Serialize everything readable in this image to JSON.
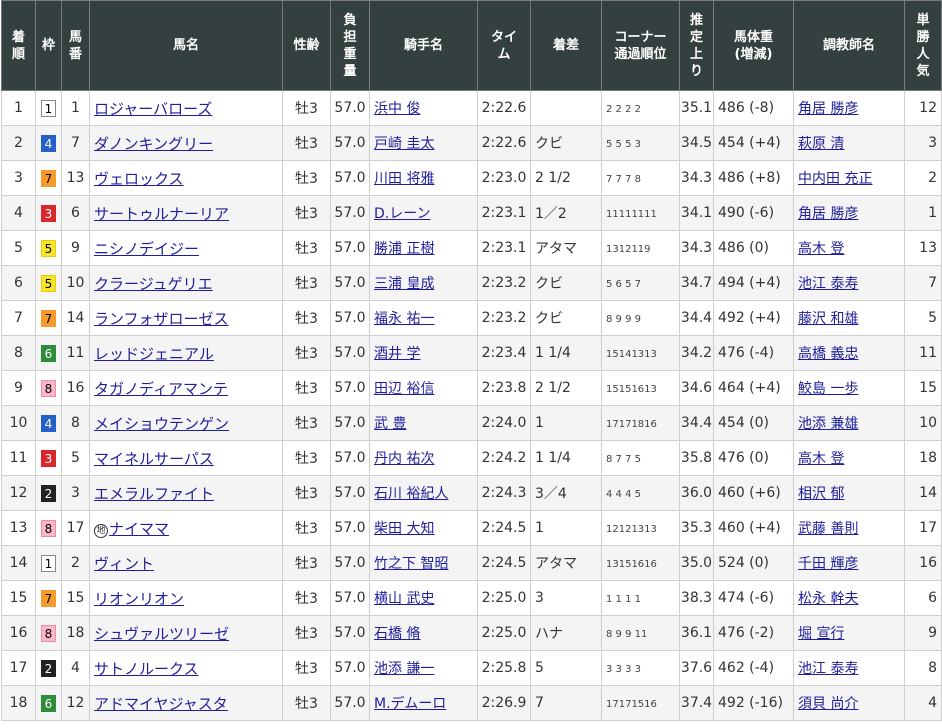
{
  "headers": {
    "rank": [
      "着",
      "順"
    ],
    "waku": "枠",
    "umaban": [
      "馬",
      "番"
    ],
    "horse": "馬名",
    "sex_age": "性齢",
    "weight_carried": [
      "負",
      "担",
      "重",
      "量"
    ],
    "jockey": "騎手名",
    "time": [
      "タイ",
      "ム"
    ],
    "margin": "着差",
    "corner": [
      "コーナー",
      "通過順位"
    ],
    "last3f": [
      "推",
      "定",
      "上",
      "り"
    ],
    "body_weight": [
      "馬体重",
      "(増減)"
    ],
    "trainer": "調教師名",
    "popularity": [
      "単",
      "勝",
      "人",
      "気"
    ]
  },
  "gate_colors": {
    "1": {
      "bg": "#ffffff",
      "fg": "#000000",
      "border": "#888888"
    },
    "2": {
      "bg": "#222222",
      "fg": "#ffffff",
      "border": "#222222"
    },
    "3": {
      "bg": "#d9282b",
      "fg": "#ffffff",
      "border": "#d9282b"
    },
    "4": {
      "bg": "#2560c8",
      "fg": "#ffffff",
      "border": "#2560c8"
    },
    "5": {
      "bg": "#f7e52a",
      "fg": "#000000",
      "border": "#e0ce10"
    },
    "6": {
      "bg": "#2e8c3a",
      "fg": "#ffffff",
      "border": "#2e8c3a"
    },
    "7": {
      "bg": "#f59a2b",
      "fg": "#000000",
      "border": "#f59a2b"
    },
    "8": {
      "bg": "#f9b8c8",
      "fg": "#000000",
      "border": "#f08aa4"
    }
  },
  "rows": [
    {
      "rank": "1",
      "waku": "1",
      "umaban": "1",
      "horse": "ロジャーバローズ",
      "chi": "",
      "sex_age": "牡3",
      "weight": "57.0",
      "jockey": "浜中 俊",
      "time": "2:22.6",
      "margin": "",
      "corner": "2 2 2 2",
      "last3f": "35.1",
      "body_weight": "486 (-8)",
      "trainer": "角居 勝彦",
      "popularity": "12"
    },
    {
      "rank": "2",
      "waku": "4",
      "umaban": "7",
      "horse": "ダノンキングリー",
      "chi": "",
      "sex_age": "牡3",
      "weight": "57.0",
      "jockey": "戸崎 圭太",
      "time": "2:22.6",
      "margin": "クビ",
      "corner": "5 5 5 3",
      "last3f": "34.5",
      "body_weight": "454 (+4)",
      "trainer": "萩原 清",
      "popularity": "3"
    },
    {
      "rank": "3",
      "waku": "7",
      "umaban": "13",
      "horse": "ヴェロックス",
      "chi": "",
      "sex_age": "牡3",
      "weight": "57.0",
      "jockey": "川田 将雅",
      "time": "2:23.0",
      "margin": "2 1/2",
      "corner": "7 7 7 8",
      "last3f": "34.3",
      "body_weight": "486 (+8)",
      "trainer": "中内田 充正",
      "popularity": "2"
    },
    {
      "rank": "4",
      "waku": "3",
      "umaban": "6",
      "horse": "サートゥルナーリア",
      "chi": "",
      "sex_age": "牡3",
      "weight": "57.0",
      "jockey": "D.レーン",
      "time": "2:23.1",
      "margin": "1／2",
      "corner": "11111111",
      "last3f": "34.1",
      "body_weight": "490 (-6)",
      "trainer": "角居 勝彦",
      "popularity": "1"
    },
    {
      "rank": "5",
      "waku": "5",
      "umaban": "9",
      "horse": "ニシノデイジー",
      "chi": "",
      "sex_age": "牡3",
      "weight": "57.0",
      "jockey": "勝浦 正樹",
      "time": "2:23.1",
      "margin": "アタマ",
      "corner": "1312119",
      "last3f": "34.3",
      "body_weight": "486 (0)",
      "trainer": "高木 登",
      "popularity": "13"
    },
    {
      "rank": "6",
      "waku": "5",
      "umaban": "10",
      "horse": "クラージュゲリエ",
      "chi": "",
      "sex_age": "牡3",
      "weight": "57.0",
      "jockey": "三浦 皇成",
      "time": "2:23.2",
      "margin": "クビ",
      "corner": "5 6 5 7",
      "last3f": "34.7",
      "body_weight": "494 (+4)",
      "trainer": "池江 泰寿",
      "popularity": "7"
    },
    {
      "rank": "7",
      "waku": "7",
      "umaban": "14",
      "horse": "ランフォザローゼス",
      "chi": "",
      "sex_age": "牡3",
      "weight": "57.0",
      "jockey": "福永 祐一",
      "time": "2:23.2",
      "margin": "クビ",
      "corner": "8 9 9 9",
      "last3f": "34.4",
      "body_weight": "492 (+4)",
      "trainer": "藤沢 和雄",
      "popularity": "5"
    },
    {
      "rank": "8",
      "waku": "6",
      "umaban": "11",
      "horse": "レッドジェニアル",
      "chi": "",
      "sex_age": "牡3",
      "weight": "57.0",
      "jockey": "酒井 学",
      "time": "2:23.4",
      "margin": "1 1/4",
      "corner": "15141313",
      "last3f": "34.2",
      "body_weight": "476 (-4)",
      "trainer": "高橋 義忠",
      "popularity": "11"
    },
    {
      "rank": "9",
      "waku": "8",
      "umaban": "16",
      "horse": "タガノディアマンテ",
      "chi": "",
      "sex_age": "牡3",
      "weight": "57.0",
      "jockey": "田辺 裕信",
      "time": "2:23.8",
      "margin": "2 1/2",
      "corner": "15151613",
      "last3f": "34.6",
      "body_weight": "464 (+4)",
      "trainer": "鮫島 一歩",
      "popularity": "15"
    },
    {
      "rank": "10",
      "waku": "4",
      "umaban": "8",
      "horse": "メイショウテンゲン",
      "chi": "",
      "sex_age": "牡3",
      "weight": "57.0",
      "jockey": "武 豊",
      "time": "2:24.0",
      "margin": "1",
      "corner": "17171816",
      "last3f": "34.4",
      "body_weight": "454 (0)",
      "trainer": "池添 兼雄",
      "popularity": "10"
    },
    {
      "rank": "11",
      "waku": "3",
      "umaban": "5",
      "horse": "マイネルサーパス",
      "chi": "",
      "sex_age": "牡3",
      "weight": "57.0",
      "jockey": "丹内 祐次",
      "time": "2:24.2",
      "margin": "1 1/4",
      "corner": "8 7 7 5",
      "last3f": "35.8",
      "body_weight": "476 (0)",
      "trainer": "高木 登",
      "popularity": "18"
    },
    {
      "rank": "12",
      "waku": "2",
      "umaban": "3",
      "horse": "エメラルファイト",
      "chi": "",
      "sex_age": "牡3",
      "weight": "57.0",
      "jockey": "石川 裕紀人",
      "time": "2:24.3",
      "margin": "3／4",
      "corner": "4 4 4 5",
      "last3f": "36.0",
      "body_weight": "460 (+6)",
      "trainer": "相沢 郁",
      "popularity": "14"
    },
    {
      "rank": "13",
      "waku": "8",
      "umaban": "17",
      "horse": "ナイママ",
      "chi": "地",
      "sex_age": "牡3",
      "weight": "57.0",
      "jockey": "柴田 大知",
      "time": "2:24.5",
      "margin": "1",
      "corner": "12121313",
      "last3f": "35.3",
      "body_weight": "460 (+4)",
      "trainer": "武藤 善則",
      "popularity": "17"
    },
    {
      "rank": "14",
      "waku": "1",
      "umaban": "2",
      "horse": "ヴィント",
      "chi": "",
      "sex_age": "牡3",
      "weight": "57.0",
      "jockey": "竹之下 智昭",
      "time": "2:24.5",
      "margin": "アタマ",
      "corner": "13151616",
      "last3f": "35.0",
      "body_weight": "524 (0)",
      "trainer": "千田 輝彦",
      "popularity": "16"
    },
    {
      "rank": "15",
      "waku": "7",
      "umaban": "15",
      "horse": "リオンリオン",
      "chi": "",
      "sex_age": "牡3",
      "weight": "57.0",
      "jockey": "横山 武史",
      "time": "2:25.0",
      "margin": "3",
      "corner": "1 1 1 1",
      "last3f": "38.3",
      "body_weight": "474 (-6)",
      "trainer": "松永 幹夫",
      "popularity": "6"
    },
    {
      "rank": "16",
      "waku": "8",
      "umaban": "18",
      "horse": "シュヴァルツリーゼ",
      "chi": "",
      "sex_age": "牡3",
      "weight": "57.0",
      "jockey": "石橋 脩",
      "time": "2:25.0",
      "margin": "ハナ",
      "corner": "8 9 9 11",
      "last3f": "36.1",
      "body_weight": "476 (-2)",
      "trainer": "堀 宣行",
      "popularity": "9"
    },
    {
      "rank": "17",
      "waku": "2",
      "umaban": "4",
      "horse": "サトノルークス",
      "chi": "",
      "sex_age": "牡3",
      "weight": "57.0",
      "jockey": "池添 謙一",
      "time": "2:25.8",
      "margin": "5",
      "corner": "3 3 3 3",
      "last3f": "37.6",
      "body_weight": "462 (-4)",
      "trainer": "池江 泰寿",
      "popularity": "8"
    },
    {
      "rank": "18",
      "waku": "6",
      "umaban": "12",
      "horse": "アドマイヤジャスタ",
      "chi": "",
      "sex_age": "牡3",
      "weight": "57.0",
      "jockey": "M.デムーロ",
      "time": "2:26.9",
      "margin": "7",
      "corner": "17171516",
      "last3f": "37.4",
      "body_weight": "492 (-16)",
      "trainer": "須貝 尚介",
      "popularity": "4"
    }
  ]
}
